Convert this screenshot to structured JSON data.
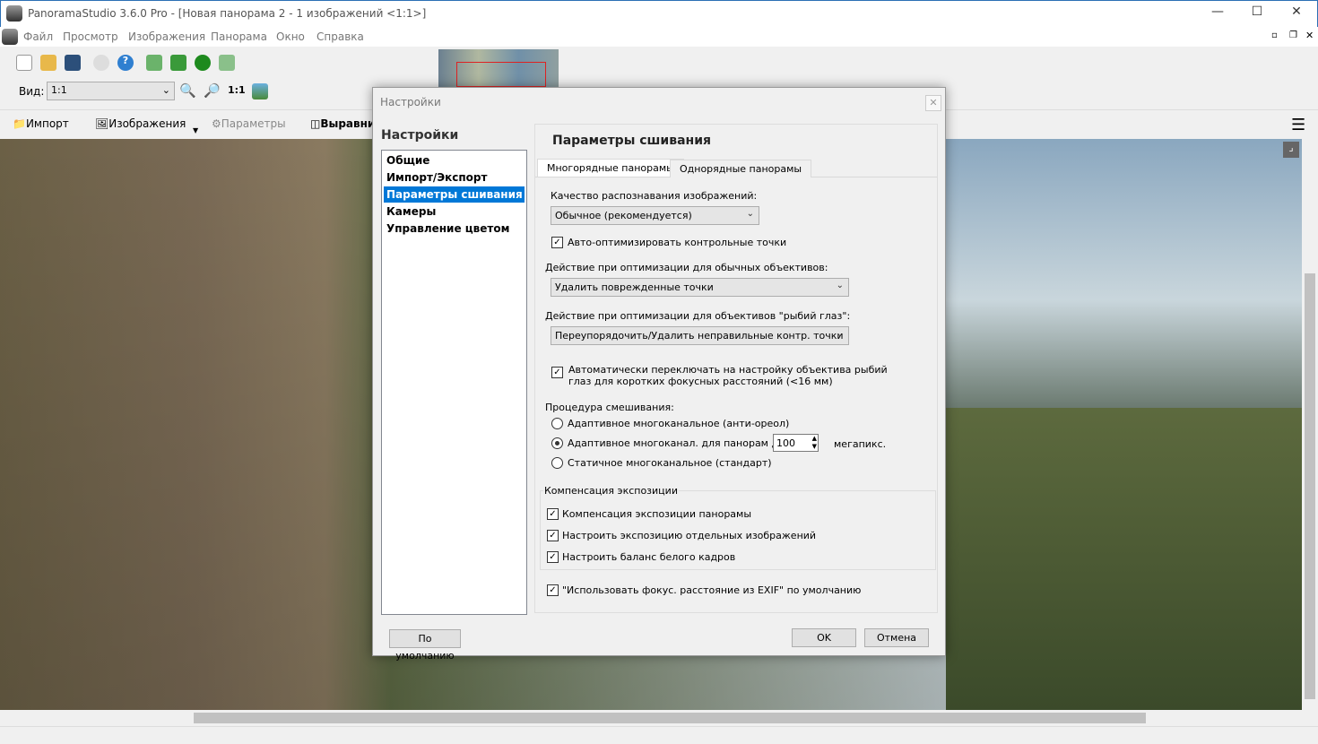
{
  "window": {
    "title": "PanoramaStudio 3.6.0 Pro - [Новая панорама 2 - 1 изображений <1:1>]",
    "logo_text": "PRO"
  },
  "menu": [
    "Файл",
    "Просмотр",
    "Изображения",
    "Панорама",
    "Окно",
    "Справка"
  ],
  "toolbar": {
    "view_label": "Вид:",
    "view_value": "1:1"
  },
  "toolbar2": {
    "import": "Импорт",
    "images": "Изображения",
    "params": "Параметры",
    "align": "Выравни"
  },
  "dialog": {
    "title": "Настройки",
    "heading": "Настройки",
    "nav": [
      "Общие",
      "Импорт/Экспорт",
      "Параметры сшивания",
      "Камеры",
      "Управление цветом"
    ],
    "selected_nav": "Параметры сшивания",
    "panel_title": "Параметры сшивания",
    "tabs": [
      "Многорядные панорамы",
      "Однорядные панорамы"
    ],
    "active_tab": "Многорядные панорамы",
    "quality_label": "Качество распознавания изображений:",
    "quality_value": "Обычное (рекомендуется)",
    "auto_opt": {
      "label": "Авто-оптимизировать контрольные точки",
      "checked": true
    },
    "normal_lens_label": "Действие при оптимизации для обычных объективов:",
    "normal_lens_value": "Удалить поврежденные точки",
    "fisheye_label": "Действие при оптимизации для объективов \"рыбий глаз\":",
    "fisheye_value": "Переупорядочить/Удалить неправильные контр. точки",
    "auto_fisheye": {
      "label1": "Автоматически переключать на настройку объектива рыбий",
      "label2": "глаз для коротких фокусных расстояний (<16 мм)",
      "checked": true
    },
    "blend_label": "Процедура смешивания:",
    "blend_options": [
      "Адаптивное многоканальное (анти-ореол)",
      "Адаптивное многоканал. для панорам до",
      "Статичное многоканальное (стандарт)"
    ],
    "blend_selected": 1,
    "megapix_value": "100",
    "megapix_unit": "мегапикс.",
    "exposure_group": "Компенсация экспозиции",
    "exposure_options": [
      {
        "label": "Компенсация экспозиции панорамы",
        "checked": true
      },
      {
        "label": "Настроить экспозицию отдельных изображений",
        "checked": true
      },
      {
        "label": "Настроить баланс белого кадров",
        "checked": true
      }
    ],
    "exif": {
      "label": "\"Использовать фокус. расстояние из EXIF\" по умолчанию",
      "checked": true
    },
    "default_btn": "По умолчанию",
    "ok_btn": "OK",
    "cancel_btn": "Отмена"
  }
}
